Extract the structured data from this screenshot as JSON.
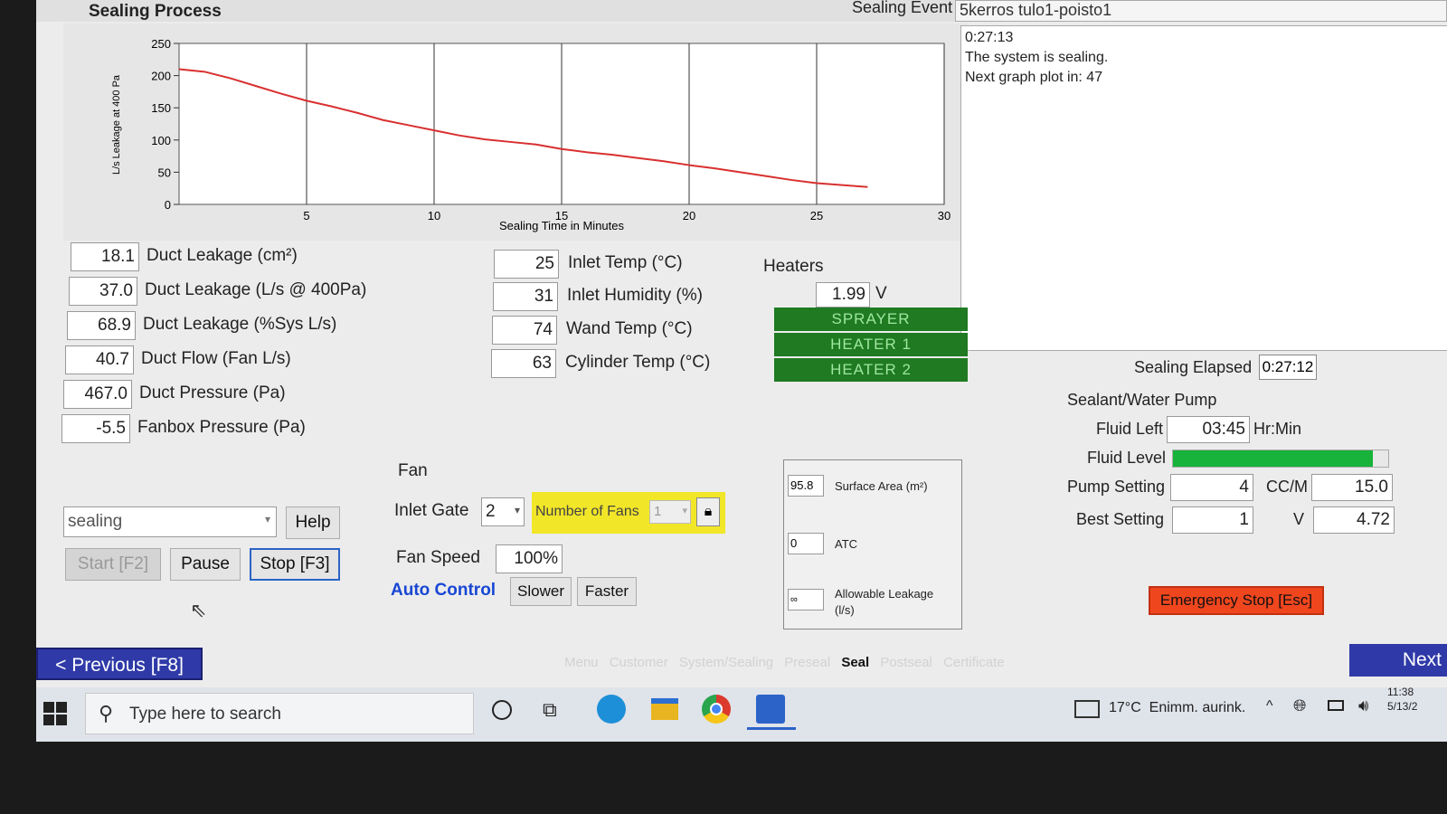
{
  "window": {
    "title": "Sealing Process"
  },
  "event": {
    "label": "Sealing Event",
    "name": "5kerros tulo1-poisto1"
  },
  "log": {
    "time": "0:27:13",
    "line1": "The system is sealing.",
    "line2": "Next graph plot in: 47"
  },
  "chart_data": {
    "type": "line",
    "xlabel": "Sealing Time in Minutes",
    "ylabel": "L/s Leakage at 400 Pa",
    "xlim": [
      0,
      30
    ],
    "ylim": [
      0,
      250
    ],
    "x_ticks": [
      "5",
      "10",
      "15",
      "20",
      "25",
      "30"
    ],
    "y_ticks": [
      "250",
      "200",
      "150",
      "100",
      "50",
      "0"
    ],
    "grid": true,
    "series": [
      {
        "color": "#d93030",
        "x": [
          0,
          1,
          2,
          3,
          4,
          5,
          6,
          7,
          8,
          9,
          10,
          11,
          12,
          13,
          14,
          15,
          16,
          17,
          18,
          19,
          20,
          21,
          22,
          23,
          24,
          25,
          26,
          27
        ],
        "y": [
          210,
          206,
          196,
          184,
          172,
          161,
          152,
          142,
          131,
          123,
          115,
          107,
          101,
          97,
          93,
          86,
          81,
          77,
          72,
          67,
          61,
          56,
          50,
          44,
          38,
          33,
          30,
          27
        ]
      }
    ]
  },
  "metrics": [
    {
      "value": "18.1",
      "label": "Duct Leakage (cm²)"
    },
    {
      "value": "37.0",
      "label": "Duct Leakage (L/s @ 400Pa)"
    },
    {
      "value": "68.9",
      "label": "Duct Leakage (%Sys L/s)"
    },
    {
      "value": "40.7",
      "label": "Duct Flow (Fan L/s)"
    },
    {
      "value": "467.0",
      "label": "Duct Pressure (Pa)"
    },
    {
      "value": "-5.5",
      "label": "Fanbox Pressure (Pa)"
    }
  ],
  "temps": [
    {
      "value": "25",
      "label": "Inlet Temp (°C)"
    },
    {
      "value": "31",
      "label": "Inlet Humidity (%)"
    },
    {
      "value": "74",
      "label": "Wand Temp (°C)"
    },
    {
      "value": "63",
      "label": "Cylinder Temp (°C)"
    }
  ],
  "heaters": {
    "title": "Heaters",
    "voltage": "1.99",
    "unit": "V",
    "sprayer": "SPRAYER",
    "heater1": "HEATER 1",
    "heater2": "HEATER 2"
  },
  "mode_select": {
    "value": "sealing"
  },
  "buttons": {
    "help": "Help",
    "start": "Start [F2]",
    "pause": "Pause",
    "stop": "Stop [F3]",
    "previous": "< Previous [F8]",
    "next": "Next",
    "slower": "Slower",
    "faster": "Faster",
    "emergency": "Emergency Stop [Esc]"
  },
  "fan": {
    "title": "Fan",
    "inlet_gate_label": "Inlet Gate",
    "inlet_gate_value": "2",
    "num_fans_label": "Number of Fans",
    "num_fans_value": "1",
    "speed_label": "Fan Speed",
    "speed_value": "100%",
    "auto_label": "Auto Control"
  },
  "area": {
    "surface_value": "95.8",
    "surface_label": "Surface Area (m²)",
    "atc_value": "0",
    "atc_label": "ATC",
    "allow_value": "∞",
    "allow_label1": "Allowable Leakage",
    "allow_label2": "(l/s)"
  },
  "pump": {
    "elapsed_label": "Sealing Elapsed",
    "elapsed_value": "0:27:12",
    "title": "Sealant/Water Pump",
    "fluid_left_label": "Fluid Left",
    "fluid_left_value": "03:45",
    "fluid_left_unit": "Hr:Min",
    "fluid_level_label": "Fluid Level",
    "fluid_level": 0.93,
    "pump_setting_label": "Pump Setting",
    "pump_setting_value": "4",
    "ccm_label": "CC/M",
    "ccm_value": "15.0",
    "best_label": "Best Setting",
    "best_value": "1",
    "v_label": "V",
    "v_value": "4.72"
  },
  "tabs": {
    "menu": "Menu",
    "customer": "Customer",
    "system": "System/Sealing",
    "preseal": "Preseal",
    "seal": "Seal",
    "postseal": "Postseal",
    "certificate": "Certificate"
  },
  "taskbar": {
    "search_placeholder": "Type here to search",
    "weather": "17°C  Enimm. aurink.",
    "time": "11:38",
    "date": "5/13/2"
  }
}
